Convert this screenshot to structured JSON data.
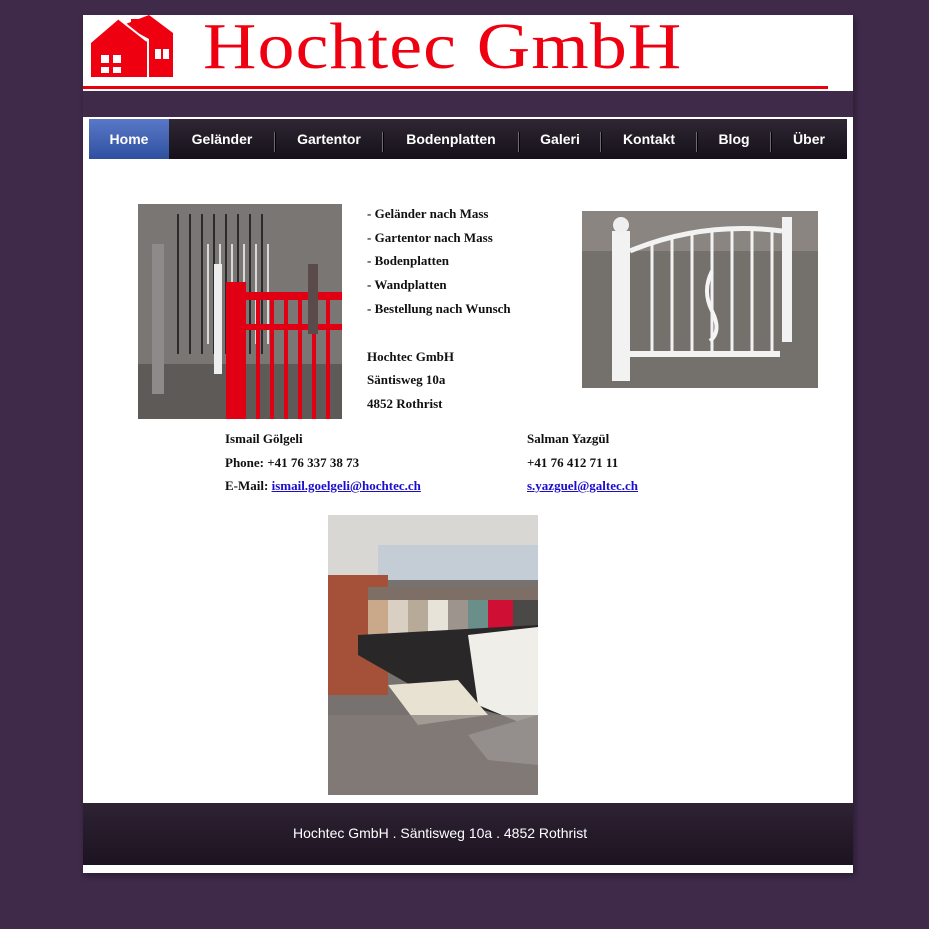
{
  "header": {
    "logo_icon": "house-logo-icon",
    "logo_text": "Hochtec GmbH",
    "brand_color": "#ee0011"
  },
  "nav": {
    "items": [
      {
        "label": "Home",
        "active": true
      },
      {
        "label": "Geländer"
      },
      {
        "label": "Gartentor"
      },
      {
        "label": "Bodenplatten"
      },
      {
        "label": "Galeri"
      },
      {
        "label": "Kontakt"
      },
      {
        "label": "Blog"
      },
      {
        "label": "Über"
      }
    ]
  },
  "intro": {
    "services": [
      "- Geländer nach Mass",
      "- Gartentor nach Mass",
      "- Bodenplatten",
      "- Wandplatten",
      "- Bestellung nach Wunsch"
    ],
    "company": "Hochtec GmbH",
    "street": "Säntisweg 10a",
    "city": "4852 Rothrist"
  },
  "contacts": {
    "left": {
      "name": "Ismail Gölgeli",
      "phone": "Phone: +41 76 337 38 73",
      "email_label": "E-Mail: ",
      "email": "ismail.goelgeli@hochtec.ch"
    },
    "right": {
      "name": "Salman Yazgül",
      "phone": "+41 76 412 71 11",
      "email": "s.yazguel@galtec.ch"
    }
  },
  "footer": {
    "text": "Hochtec GmbH . Säntisweg 10a . 4852 Rothrist"
  }
}
